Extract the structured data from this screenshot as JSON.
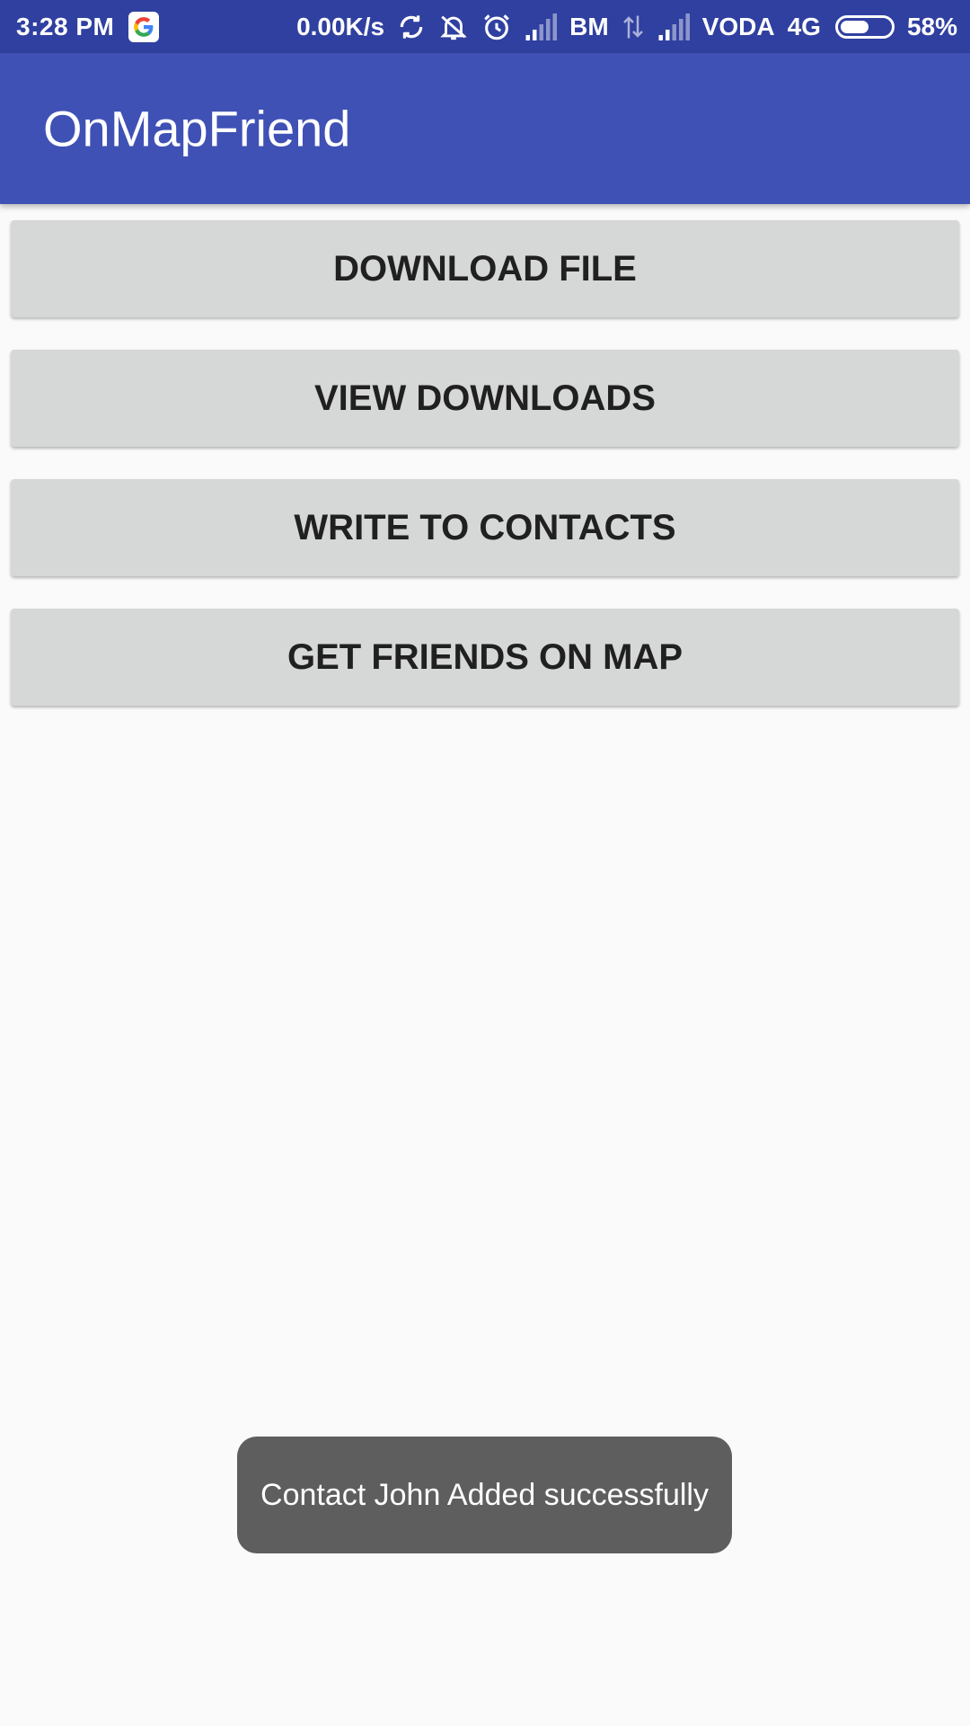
{
  "status_bar": {
    "time": "3:28 PM",
    "speed": "0.00K/s",
    "carrier1": "BM",
    "carrier2": "VODA",
    "network": "4G",
    "battery_pct": "58%",
    "battery_level": 0.58,
    "icons": [
      "google-icon",
      "sync-icon",
      "notifications-off-icon",
      "alarm-icon",
      "signal-icon",
      "data-arrows-icon",
      "signal-icon",
      "battery-icon"
    ]
  },
  "app_bar": {
    "title": "OnMapFriend",
    "color": "#3f51b5"
  },
  "buttons": {
    "download_file": "DOWNLOAD FILE",
    "view_downloads": "VIEW DOWNLOADS",
    "write_to_contacts": "WRITE TO CONTACTS",
    "get_friends_on_map": "GET FRIENDS ON MAP"
  },
  "toast": {
    "message": "Contact John Added successfully"
  }
}
